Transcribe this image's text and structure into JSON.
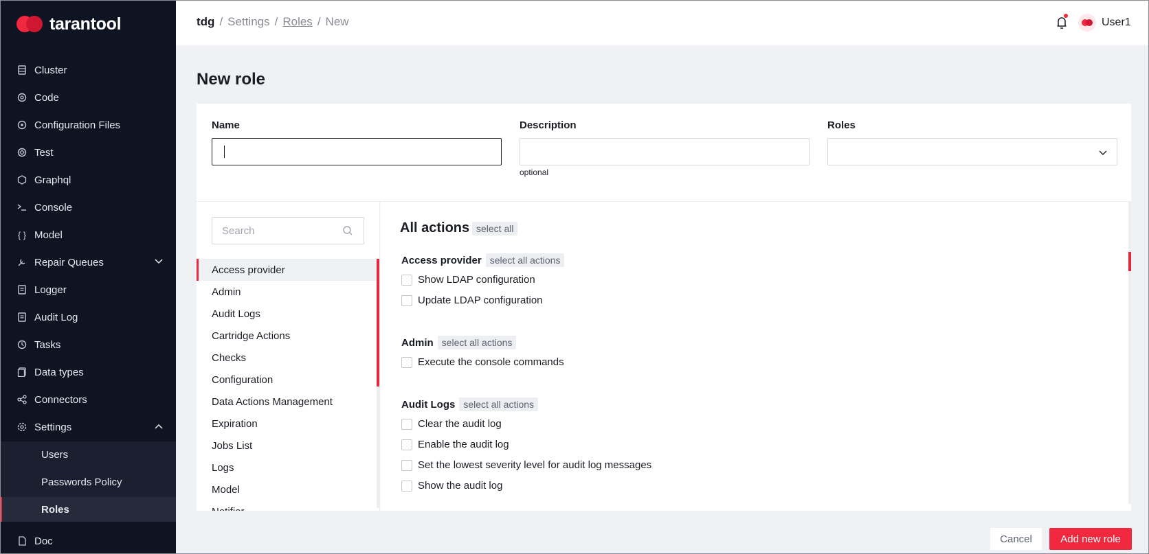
{
  "app": {
    "logo_text": "tarantool"
  },
  "sidebar": {
    "items": [
      {
        "label": "Cluster",
        "icon": "cluster-icon"
      },
      {
        "label": "Code",
        "icon": "code-icon"
      },
      {
        "label": "Configuration Files",
        "icon": "config-files-icon"
      },
      {
        "label": "Test",
        "icon": "test-icon"
      },
      {
        "label": "Graphql",
        "icon": "graphql-icon"
      },
      {
        "label": "Console",
        "icon": "console-icon"
      },
      {
        "label": "Model",
        "icon": "model-icon"
      },
      {
        "label": "Repair Queues",
        "icon": "repair-icon",
        "expandable": true,
        "expanded": false
      },
      {
        "label": "Logger",
        "icon": "logger-icon"
      },
      {
        "label": "Audit Log",
        "icon": "audit-log-icon"
      },
      {
        "label": "Tasks",
        "icon": "tasks-icon"
      },
      {
        "label": "Data types",
        "icon": "data-types-icon"
      },
      {
        "label": "Connectors",
        "icon": "connectors-icon"
      },
      {
        "label": "Settings",
        "icon": "settings-icon",
        "expandable": true,
        "expanded": true
      },
      {
        "label": "Doc",
        "icon": "doc-icon"
      }
    ],
    "settings_children": [
      {
        "label": "Users",
        "active": false
      },
      {
        "label": "Passwords Policy",
        "active": false
      },
      {
        "label": "Roles",
        "active": true
      }
    ]
  },
  "header": {
    "breadcrumbs": [
      "tdg",
      "Settings",
      "Roles",
      "New"
    ],
    "separator": "/",
    "user_name": "User1",
    "has_notification": true
  },
  "page": {
    "title": "New role"
  },
  "form": {
    "name_label": "Name",
    "name_value": "",
    "description_label": "Description",
    "description_value": "",
    "description_hint": "optional",
    "roles_label": "Roles",
    "roles_value": ""
  },
  "categories": {
    "search_placeholder": "Search",
    "items": [
      "Access provider",
      "Admin",
      "Audit Logs",
      "Cartridge Actions",
      "Checks",
      "Configuration",
      "Data Actions Management",
      "Expiration",
      "Jobs List",
      "Logs",
      "Model",
      "Notifier"
    ],
    "active_index": 0
  },
  "actions": {
    "title": "All actions",
    "select_all_label": "select all",
    "select_group_label": "select all actions",
    "groups": [
      {
        "name": "Access provider",
        "actions": [
          "Show LDAP configuration",
          "Update LDAP configuration"
        ]
      },
      {
        "name": "Admin",
        "actions": [
          "Execute the console commands"
        ]
      },
      {
        "name": "Audit Logs",
        "actions": [
          "Clear the audit log",
          "Enable the audit log",
          "Set the lowest severity level for audit log messages",
          "Show the audit log"
        ]
      }
    ]
  },
  "footer": {
    "cancel_label": "Cancel",
    "submit_label": "Add new role"
  },
  "colors": {
    "accent": "#f0293e",
    "sidebar_bg": "#0e1422",
    "page_bg": "#f0f1f4"
  }
}
